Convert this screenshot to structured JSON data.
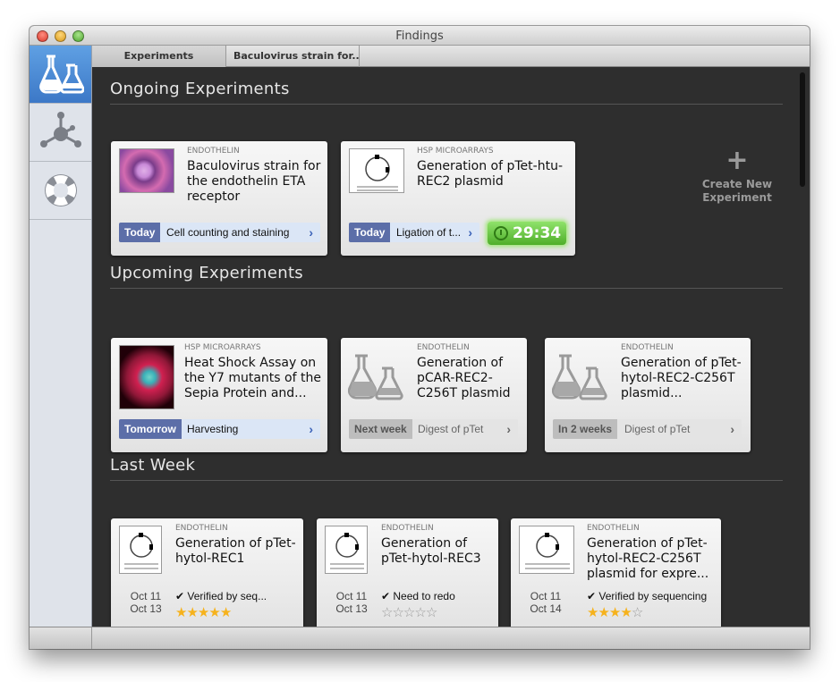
{
  "window": {
    "title": "Findings"
  },
  "tabs": [
    "Experiments",
    "Baculovirus strain for..."
  ],
  "sidebar": {
    "items": [
      {
        "name": "experiments",
        "icon": "flask-icon"
      },
      {
        "name": "network",
        "icon": "network-icon"
      },
      {
        "name": "help",
        "icon": "lifebuoy-icon"
      }
    ]
  },
  "ongoing": {
    "title": "Ongoing Experiments",
    "cards": [
      {
        "category": "ENDOTHELIN",
        "title": "Baculovirus strain for the endothelin ETA receptor",
        "when": "Today",
        "task": "Cell counting and staining"
      },
      {
        "category": "HSP MICROARRAYS",
        "title": "Generation of pTet-htu-REC2 plasmid",
        "when": "Today",
        "task": "Ligation of t...",
        "timer": "29:34"
      }
    ],
    "create_label": "Create New Experiment"
  },
  "upcoming": {
    "title": "Upcoming Experiments",
    "cards": [
      {
        "category": "HSP MICROARRAYS",
        "title": "Heat Shock Assay on the Y7 mutants of the Sepia Protein and...",
        "when": "Tomorrow",
        "task": "Harvesting"
      },
      {
        "category": "ENDOTHELIN",
        "title": "Generation of pCAR-REC2-C256T plasmid",
        "when": "Next week",
        "task": "Digest of pTet"
      },
      {
        "category": "ENDOTHELIN",
        "title": "Generation of pTet-hytol-REC2-C256T plasmid...",
        "when": "In 2 weeks",
        "task": "Digest of pTet"
      }
    ]
  },
  "lastweek": {
    "title": "Last Week",
    "cards": [
      {
        "category": "ENDOTHELIN",
        "title": "Generation of pTet-hytol-REC1",
        "date_start": "Oct 11",
        "date_end": "Oct 13",
        "status": "✔ Verified by seq...",
        "rating": 5
      },
      {
        "category": "ENDOTHELIN",
        "title": "Generation of pTet-hytol-REC3",
        "date_start": "Oct 11",
        "date_end": "Oct 13",
        "status": "✔ Need to redo",
        "rating": 0
      },
      {
        "category": "ENDOTHELIN",
        "title": "Generation of pTet-hytol-REC2-C256T plasmid for expre...",
        "date_start": "Oct 11",
        "date_end": "Oct 14",
        "status": "✔ Verified by sequencing",
        "rating": 4
      }
    ]
  },
  "colors": {
    "accent": "#3c78c7",
    "today_badge": "#5c6ea8",
    "timer": "#4fae2a",
    "star": "#f6b21c"
  }
}
